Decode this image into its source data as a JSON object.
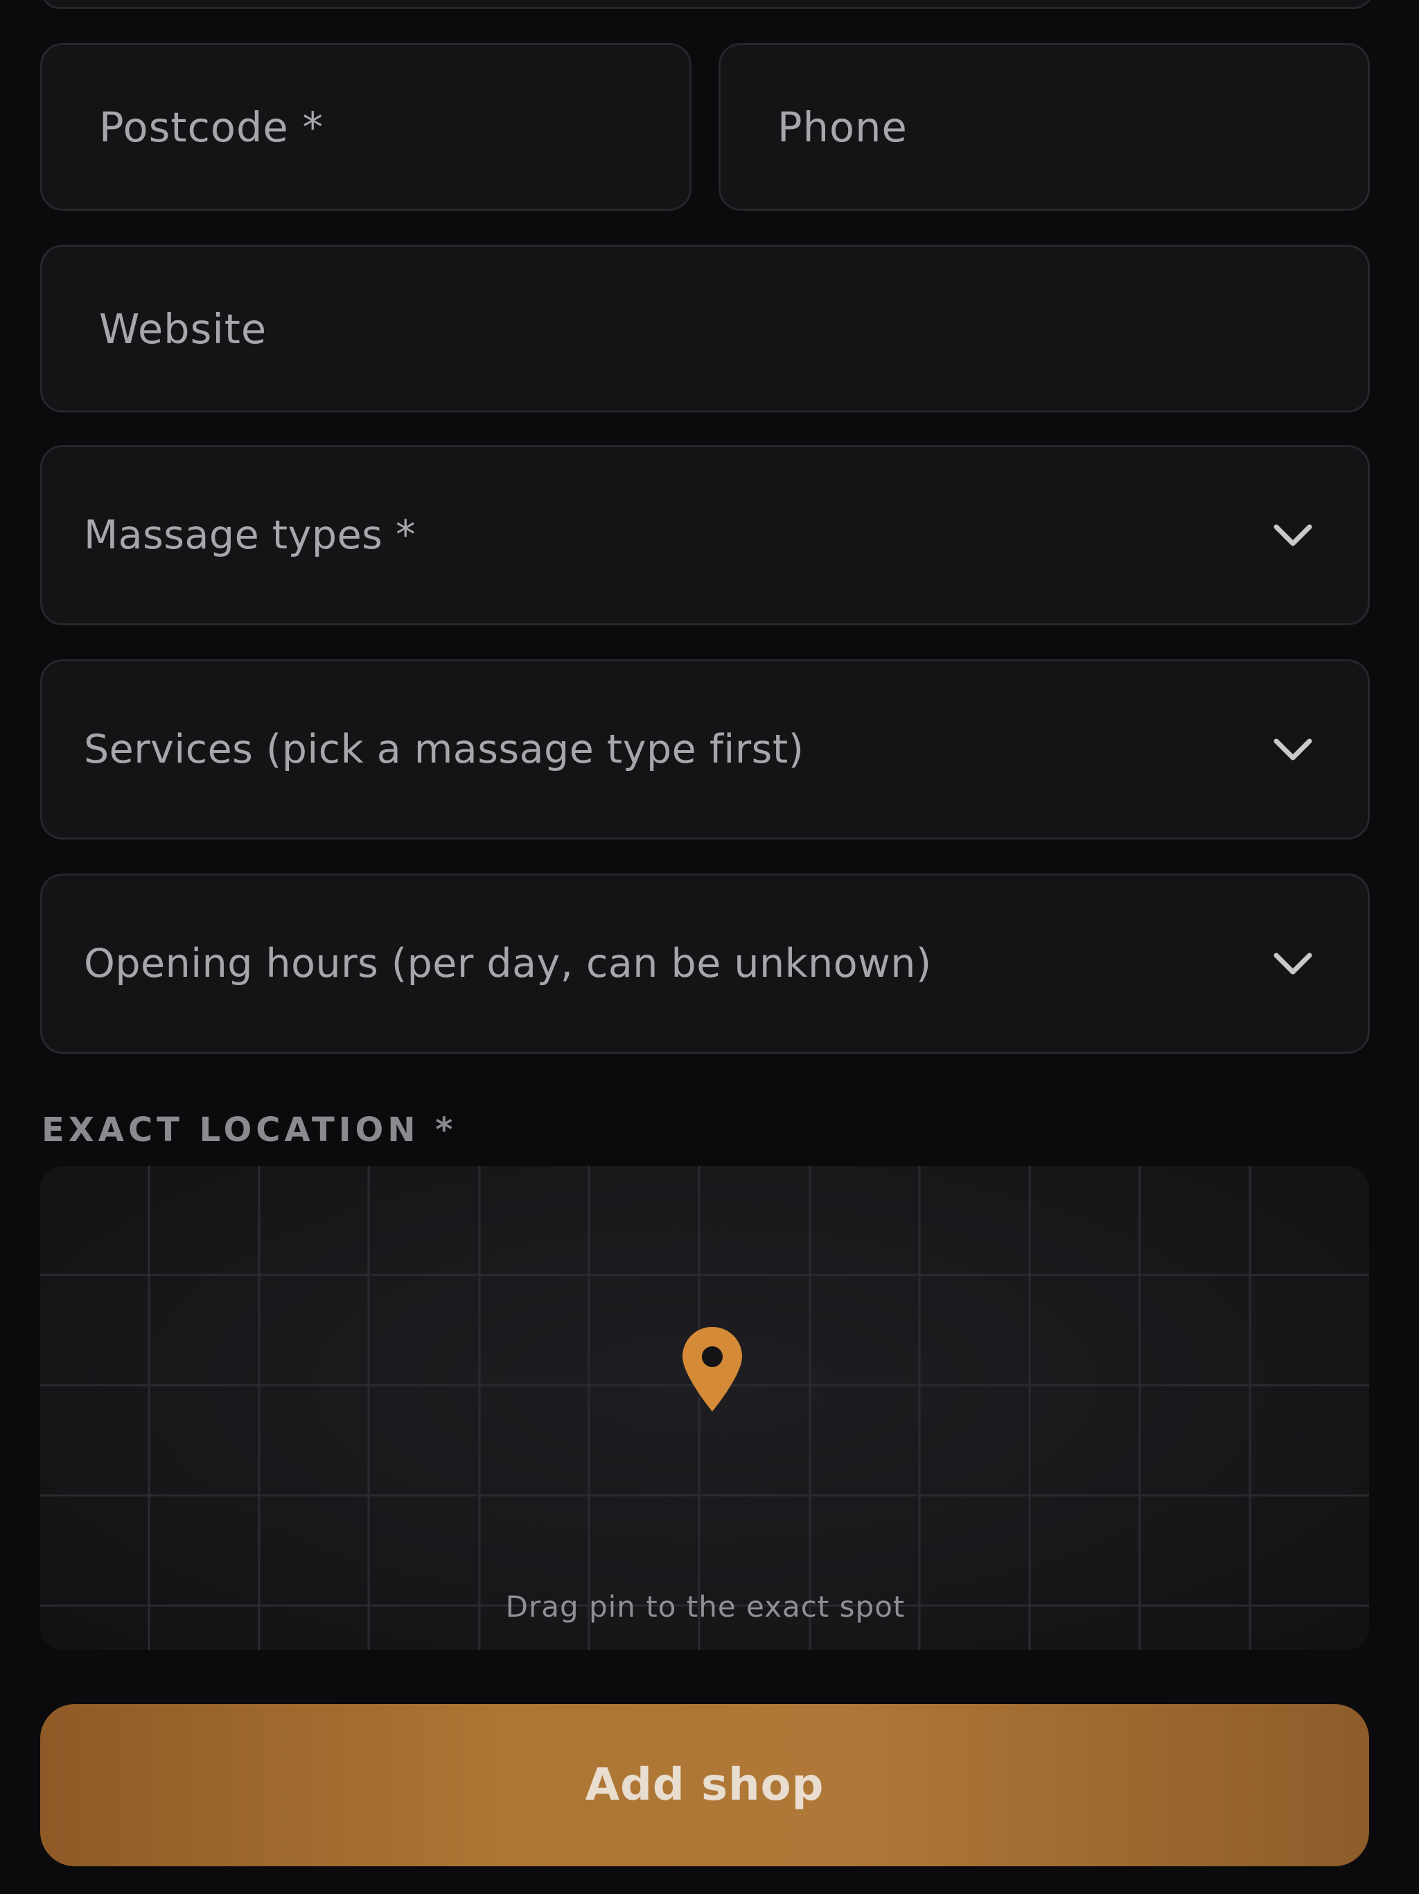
{
  "form": {
    "postcode": {
      "placeholder": "Postcode *",
      "value": ""
    },
    "phone": {
      "placeholder": "Phone",
      "value": ""
    },
    "website": {
      "placeholder": "Website",
      "value": ""
    },
    "massage_types": {
      "label": "Massage types *",
      "icon": "chevron-down-icon"
    },
    "services": {
      "label": "Services (pick a massage type first)",
      "icon": "chevron-down-icon"
    },
    "opening_hours": {
      "label": "Opening hours (per day, can be unknown)",
      "icon": "chevron-down-icon"
    }
  },
  "location": {
    "section_label": "EXACT LOCATION *",
    "hint": "Drag pin to the exact spot",
    "pin_icon": "map-pin-icon",
    "pin_color": "#d58a37"
  },
  "actions": {
    "submit_label": "Add shop",
    "accent_color": "#b07838"
  }
}
